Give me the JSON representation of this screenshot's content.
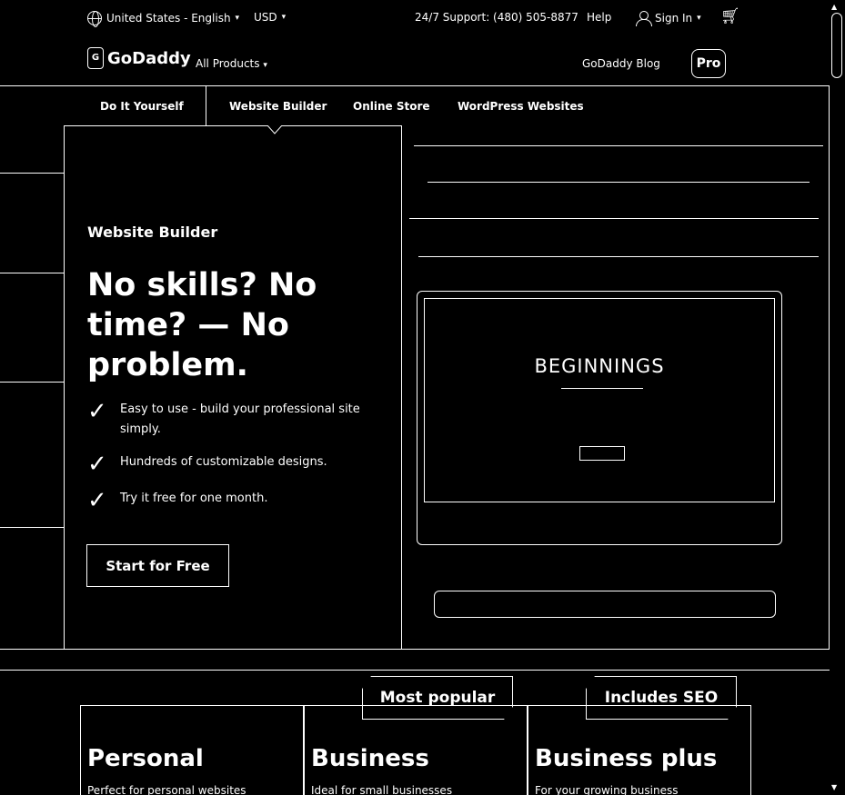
{
  "utility_bar": {
    "locale": "United States - English",
    "currency": "USD",
    "support": "24/7 Support: (480) 505-8877",
    "help": "Help",
    "sign_in": "Sign In"
  },
  "header": {
    "logo_text": "GoDaddy",
    "all_products": "All Products",
    "blog": "GoDaddy Blog",
    "pro": "Pro"
  },
  "subnav": {
    "items": [
      "Do It Yourself",
      "Website Builder",
      "Online Store",
      "WordPress Websites"
    ]
  },
  "hero": {
    "eyebrow": "Website Builder",
    "headline": "No skills? No time? — No problem.",
    "bullets": [
      "Easy to use - build your professional site simply.",
      "Hundreds of customizable designs.",
      "Try it free for one month."
    ],
    "cta": "Start for Free",
    "screen_title": "BEGINNINGS"
  },
  "pricing": {
    "ribbons": [
      "Most popular",
      "Includes SEO"
    ],
    "plans": [
      {
        "name": "Personal",
        "desc": "Perfect for personal websites"
      },
      {
        "name": "Business",
        "desc": "Ideal for small businesses"
      },
      {
        "name": "Business plus",
        "desc": "For your growing business"
      }
    ]
  },
  "icons": [
    "globe-icon",
    "chevron-down-icon",
    "person-icon",
    "cart-icon",
    "checkmark-icon"
  ]
}
